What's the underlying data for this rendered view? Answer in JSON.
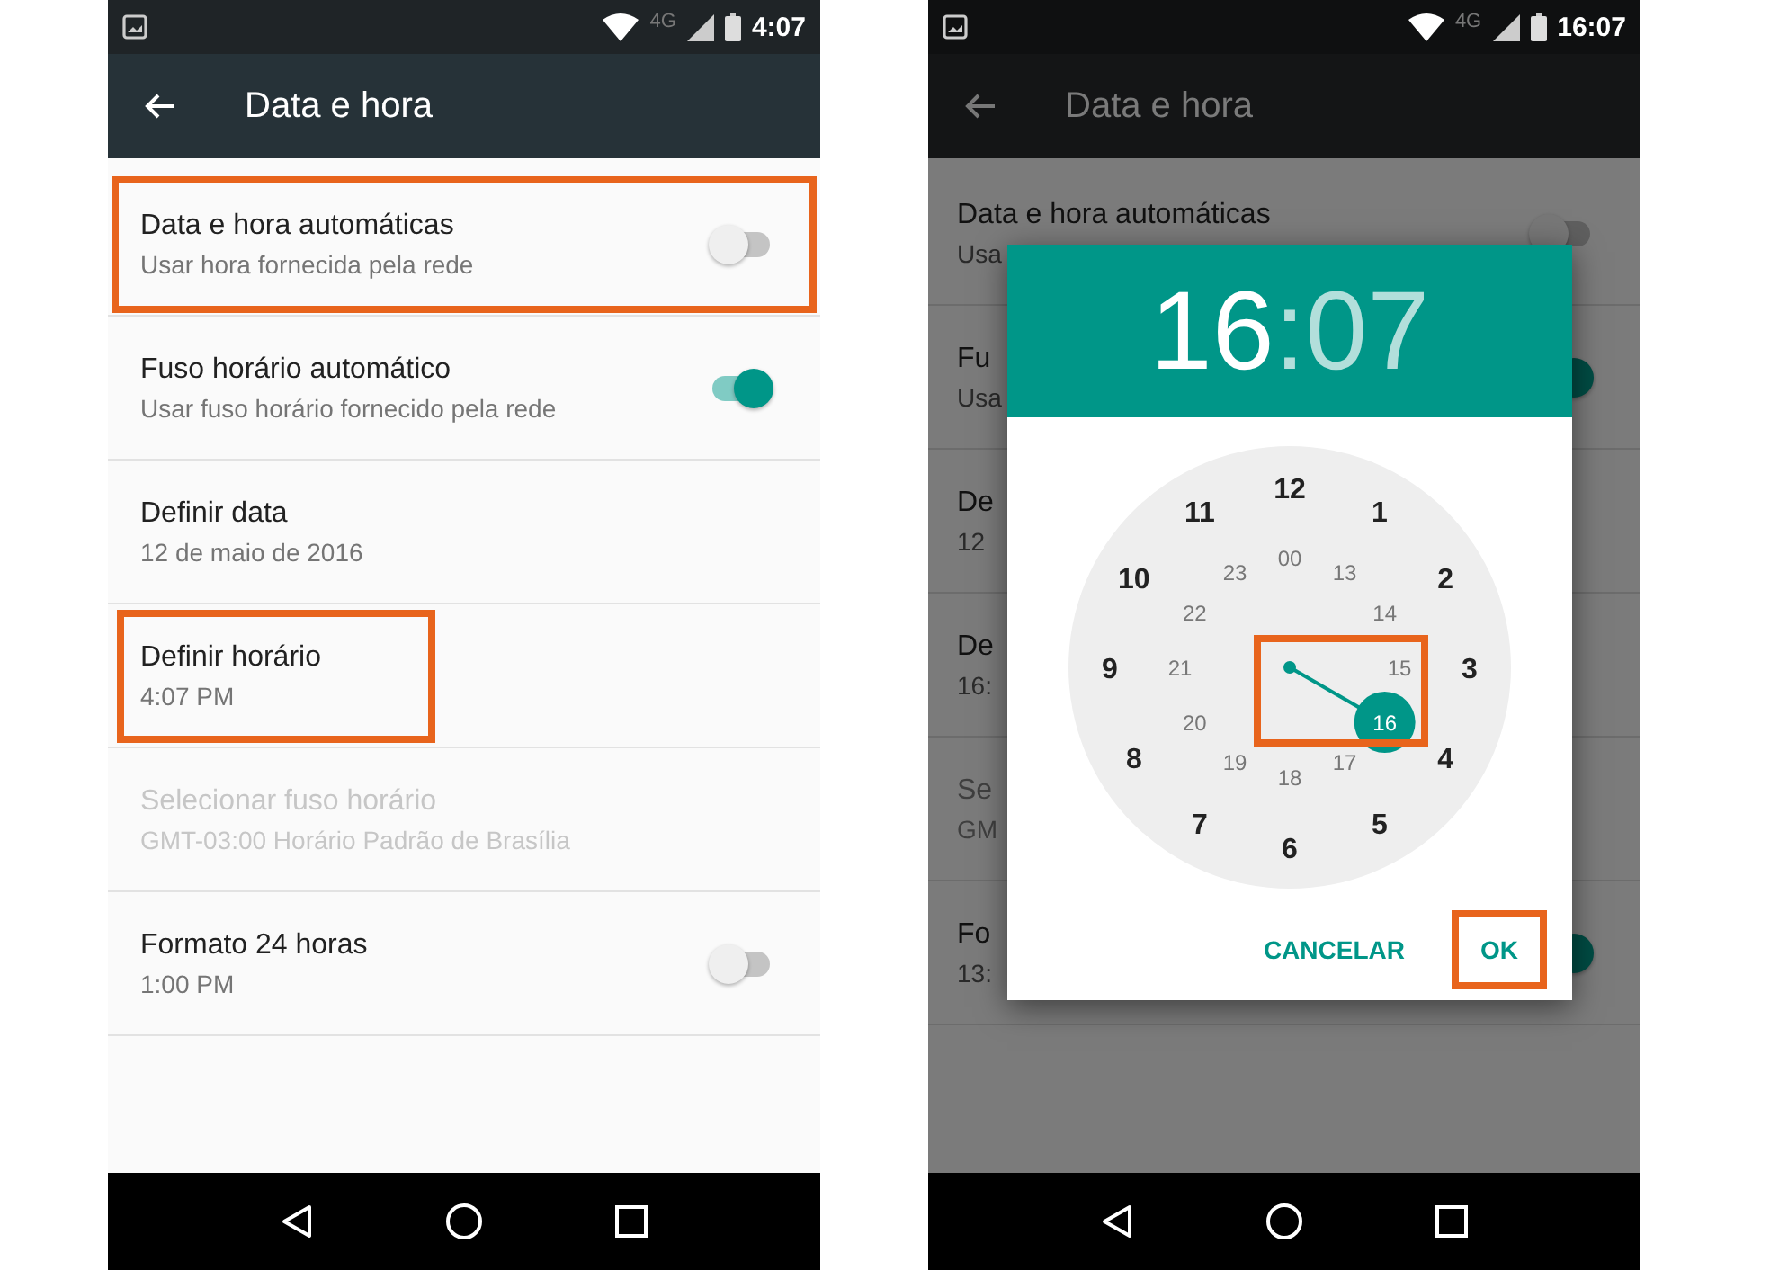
{
  "phones": [
    {
      "status_bar": {
        "network": "4G",
        "time": "4:07"
      },
      "toolbar": {
        "title": "Data e hora"
      },
      "items": [
        {
          "kind": "switch",
          "title": "Data e hora automáticas",
          "summary": "Usar hora fornecida pela rede",
          "on": false,
          "disabled": false,
          "highlighted": true
        },
        {
          "kind": "switch",
          "title": "Fuso horário automático",
          "summary": "Usar fuso horário fornecido pela rede",
          "on": true,
          "disabled": false,
          "highlighted": false
        },
        {
          "kind": "plain",
          "title": "Definir data",
          "summary": "12 de maio de 2016",
          "disabled": false,
          "highlighted": false
        },
        {
          "kind": "plain",
          "title": "Definir horário",
          "summary": "4:07 PM",
          "disabled": false,
          "highlighted": true
        },
        {
          "kind": "plain",
          "title": "Selecionar fuso horário",
          "summary": "GMT-03:00 Horário Padrão de Brasília",
          "disabled": true,
          "highlighted": false
        },
        {
          "kind": "switch",
          "title": "Formato 24 horas",
          "summary": "1:00 PM",
          "on": false,
          "disabled": false,
          "highlighted": false
        }
      ]
    },
    {
      "status_bar": {
        "network": "4G",
        "time": "16:07"
      },
      "toolbar": {
        "title": "Data e hora"
      },
      "items": [
        {
          "kind": "switch",
          "title": "Data e hora automáticas",
          "summary": "Usa",
          "on": false,
          "disabled": false,
          "highlighted": false
        },
        {
          "kind": "switch",
          "title": "Fu",
          "summary": "Usa",
          "on": true,
          "disabled": false,
          "highlighted": false
        },
        {
          "kind": "plain",
          "title": "De",
          "summary": "12",
          "disabled": false,
          "highlighted": false
        },
        {
          "kind": "plain",
          "title": "De",
          "summary": "16:",
          "disabled": false,
          "highlighted": false
        },
        {
          "kind": "plain",
          "title": "Se",
          "summary": "GM",
          "disabled": true,
          "highlighted": false
        },
        {
          "kind": "switch",
          "title": "Fo",
          "summary": "13:",
          "on": true,
          "disabled": false,
          "highlighted": false
        }
      ],
      "dialog": {
        "header": {
          "hours": {
            "text": "16",
            "selected": true
          },
          "separator": ":",
          "minutes": {
            "text": "07",
            "selected": false
          }
        },
        "dial": {
          "highlighted": true,
          "outer": [
            {
              "label": "12",
              "selected": false
            },
            {
              "label": "1",
              "selected": false
            },
            {
              "label": "2",
              "selected": false
            },
            {
              "label": "3",
              "selected": false
            },
            {
              "label": "4",
              "selected": false
            },
            {
              "label": "5",
              "selected": false
            },
            {
              "label": "6",
              "selected": false
            },
            {
              "label": "7",
              "selected": false
            },
            {
              "label": "8",
              "selected": false
            },
            {
              "label": "9",
              "selected": false
            },
            {
              "label": "10",
              "selected": false
            },
            {
              "label": "11",
              "selected": false
            }
          ],
          "inner": [
            {
              "label": "00",
              "selected": false
            },
            {
              "label": "13",
              "selected": false
            },
            {
              "label": "14",
              "selected": false
            },
            {
              "label": "15",
              "selected": false
            },
            {
              "label": "16",
              "selected": true
            },
            {
              "label": "17",
              "selected": false
            },
            {
              "label": "18",
              "selected": false
            },
            {
              "label": "19",
              "selected": false
            },
            {
              "label": "20",
              "selected": false
            },
            {
              "label": "21",
              "selected": false
            },
            {
              "label": "22",
              "selected": false
            },
            {
              "label": "23",
              "selected": false
            }
          ]
        },
        "buttons": [
          {
            "label": "CANCELAR",
            "highlighted": false
          },
          {
            "label": "OK",
            "highlighted": true
          }
        ]
      }
    }
  ]
}
